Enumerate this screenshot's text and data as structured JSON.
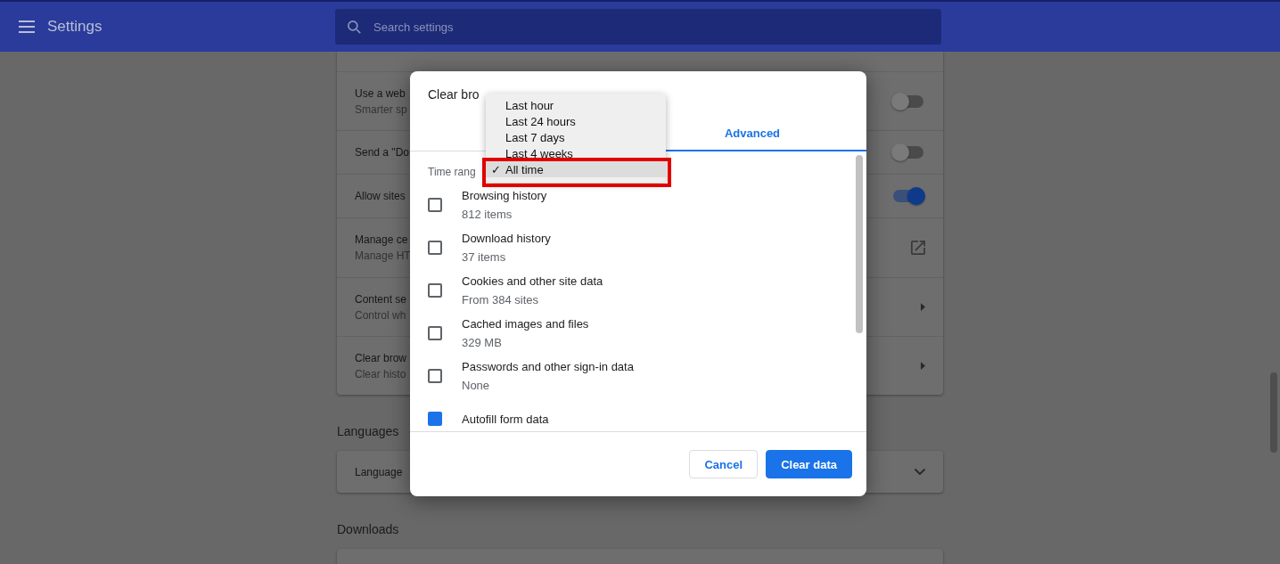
{
  "header": {
    "title": "Settings",
    "search_placeholder": "Search settings"
  },
  "settings_rows": [
    {
      "kind": "toggle",
      "title": "Use a web",
      "subtitle": "Smarter sp",
      "on": false
    },
    {
      "kind": "toggle",
      "title": "Send a \"Do",
      "on": false
    },
    {
      "kind": "toggle",
      "title": "Allow sites",
      "on": true
    },
    {
      "kind": "external",
      "title": "Manage ce",
      "subtitle": "Manage HT"
    },
    {
      "kind": "arrow",
      "title": "Content se",
      "subtitle": "Control wh"
    },
    {
      "kind": "arrow",
      "title": "Clear brow",
      "subtitle": "Clear histo"
    }
  ],
  "sections": [
    {
      "heading": "Languages",
      "row": "Language"
    },
    {
      "heading": "Downloads"
    }
  ],
  "dialog": {
    "title": "Clear bro",
    "tabs": [
      {
        "label": "Advanced",
        "selected": true
      }
    ],
    "time_range_label": "Time rang",
    "time_options": [
      {
        "label": "Last hour",
        "selected": false
      },
      {
        "label": "Last 24 hours",
        "selected": false
      },
      {
        "label": "Last 7 days",
        "selected": false
      },
      {
        "label": "Last 4 weeks",
        "selected": false
      },
      {
        "label": "All time",
        "selected": true
      }
    ],
    "check_mark": "✓",
    "items": [
      {
        "title": "Browsing history",
        "detail": "812 items",
        "checked": false
      },
      {
        "title": "Download history",
        "detail": "37 items",
        "checked": false
      },
      {
        "title": "Cookies and other site data",
        "detail": "From 384 sites",
        "checked": false
      },
      {
        "title": "Cached images and files",
        "detail": "329 MB",
        "checked": false
      },
      {
        "title": "Passwords and other sign-in data",
        "detail": "None",
        "checked": false
      },
      {
        "title": "Autofill form data",
        "checked": true
      }
    ],
    "buttons": [
      {
        "label": "Cancel",
        "kind": "secondary"
      },
      {
        "label": "Clear data",
        "kind": "primary"
      }
    ]
  }
}
